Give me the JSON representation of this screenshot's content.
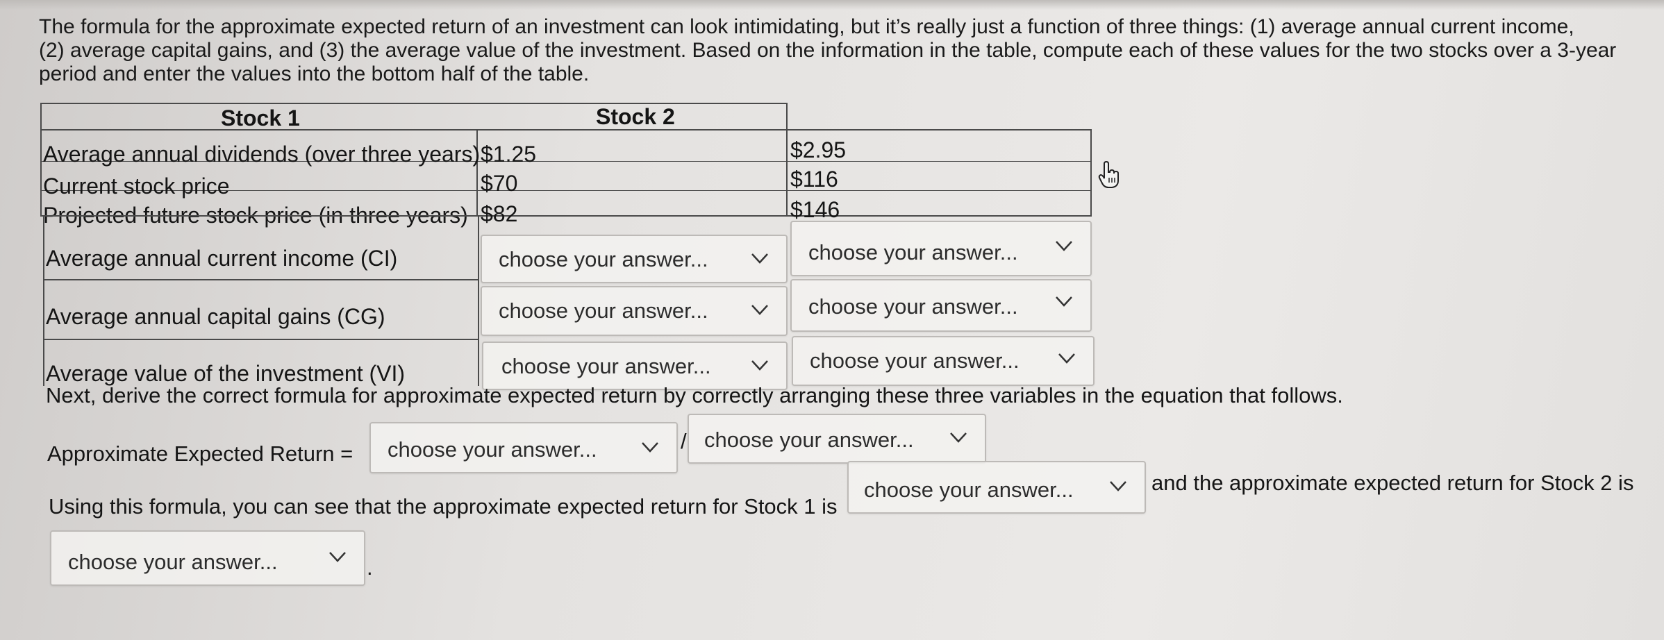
{
  "intro": {
    "line1": "The formula for the approximate expected return of an investment can look intimidating, but it’s really just a function of three things: (1) average annual current income,",
    "line2": "(2) average capital gains, and (3) the average value of the investment. Based on the information in the table, compute each of these values for the two stocks over a 3-year",
    "line3": "period and enter the values into the bottom half of the table."
  },
  "table": {
    "col1_header": "Stock 1",
    "col2_header": "Stock 2",
    "rows": [
      {
        "label": "Average annual dividends (over three years)",
        "stock1": "$1.25",
        "stock2": "$2.95"
      },
      {
        "label": "Current stock price",
        "stock1": "$70",
        "stock2": "$116"
      },
      {
        "label": "Projected future stock price (in three years)",
        "stock1": "$82",
        "stock2": "$146"
      }
    ],
    "answer_rows": [
      {
        "label": "Average annual current income (CI)",
        "stock1": "choose your answer...",
        "stock2": "choose your answer..."
      },
      {
        "label": "Average annual capital gains (CG)",
        "stock1": "choose your answer...",
        "stock2": "choose your answer..."
      },
      {
        "label": "Average value of the investment (VI)",
        "stock1": "choose your answer...",
        "stock2": "choose your answer..."
      }
    ]
  },
  "formula": {
    "instruction": "Next, derive the correct formula for approximate expected return by correctly arranging these three variables in the equation that follows.",
    "label": "Approximate Expected Return =",
    "numerator": "choose your answer...",
    "slash": "/",
    "denominator": "choose your answer..."
  },
  "conclusion": {
    "text1": "Using this formula, you can see that the approximate expected return for Stock 1 is",
    "stock1_answer": "choose your answer...",
    "text2": "and the approximate expected return for Stock 2 is",
    "stock2_answer": "choose your answer...",
    "period": "."
  },
  "icons": {
    "dropdown": "chevron-down-icon",
    "cursor": "hand-pointer-icon"
  }
}
